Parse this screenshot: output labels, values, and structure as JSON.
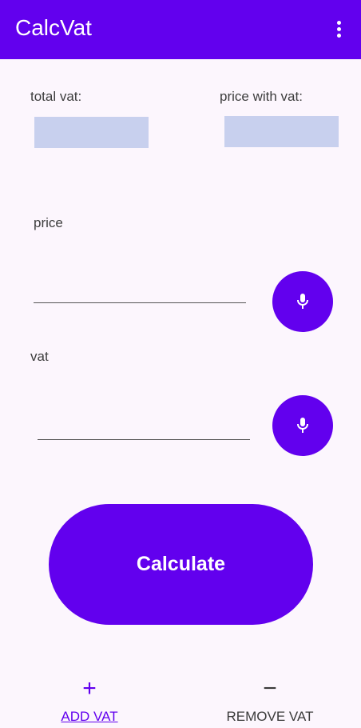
{
  "appbar": {
    "title": "CalcVat",
    "menu_icon": "more-vert-icon",
    "color": "#6200EE"
  },
  "results": {
    "total_vat_label": "total vat:",
    "total_vat_value": "",
    "price_with_vat_label": "price with vat:",
    "price_with_vat_value": "",
    "box_color": "#C8D0EE"
  },
  "form": {
    "price_label": "price",
    "price_value": "",
    "vat_label": "vat",
    "vat_value": "",
    "mic_icon": "mic-icon"
  },
  "calculate_button": {
    "label": "Calculate"
  },
  "bottom_nav": {
    "add": {
      "icon": "+",
      "icon_name": "plus-icon",
      "label": "ADD VAT",
      "color": "#6200EE"
    },
    "remove": {
      "icon": "−",
      "icon_name": "minus-icon",
      "label": "REMOVE VAT",
      "color": "#3a3a3a"
    }
  }
}
